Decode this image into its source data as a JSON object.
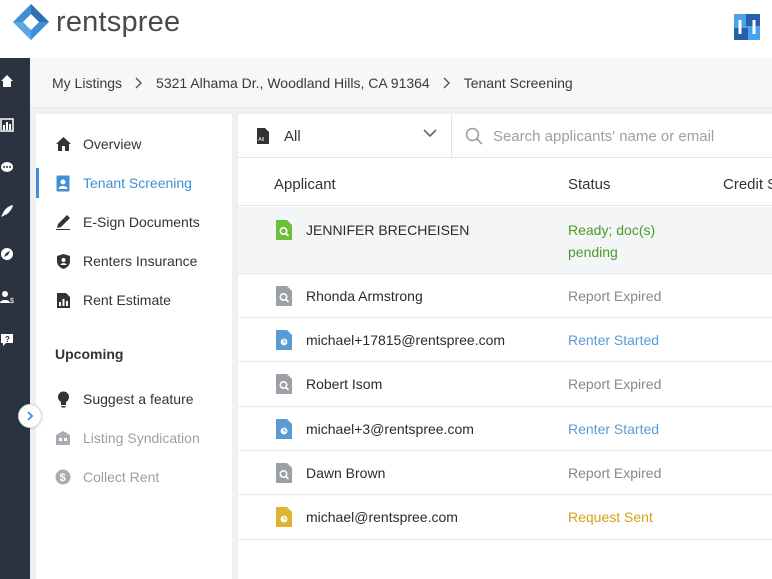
{
  "app": {
    "logo_text": "rentspree",
    "colors": {
      "accent": "#3f8fd6",
      "rail": "#2b3240",
      "ready": "#4c9a2a",
      "started": "#5b9bd5",
      "sent": "#d4a017",
      "expired": "#888888"
    }
  },
  "breadcrumb": [
    "My Listings",
    "5321 Alhama Dr., Woodland Hills, CA 91364",
    "Tenant Screening"
  ],
  "rail_icons": [
    "home-icon",
    "chart-icon",
    "chat-icon",
    "rocket-icon",
    "compass-icon",
    "users-dollar-icon",
    "help-icon"
  ],
  "subnav": {
    "items": [
      {
        "label": "Overview",
        "icon": "home-icon"
      },
      {
        "label": "Tenant Screening",
        "icon": "person-doc-icon"
      },
      {
        "label": "E-Sign Documents",
        "icon": "pen-icon"
      },
      {
        "label": "Renters Insurance",
        "icon": "shield-icon"
      },
      {
        "label": "Rent Estimate",
        "icon": "estimate-icon"
      }
    ],
    "upcoming_heading": "Upcoming",
    "upcoming": [
      {
        "label": "Suggest a feature",
        "icon": "lightbulb-icon"
      },
      {
        "label": "Listing Syndication",
        "icon": "building-icon"
      },
      {
        "label": "Collect Rent",
        "icon": "dollar-icon"
      }
    ]
  },
  "filter": {
    "selected": "All",
    "doc_badge": "All"
  },
  "search": {
    "placeholder": "Search applicants' name or email"
  },
  "table": {
    "columns": [
      "Applicant",
      "Status",
      "Credit S"
    ],
    "rows": [
      {
        "name": "JENNIFER BRECHEISEN",
        "status_line1": "Ready; doc(s)",
        "status_line2": "pending",
        "kind": "ready"
      },
      {
        "name": "Rhonda Armstrong",
        "status_line1": "Report Expired",
        "status_line2": "",
        "kind": "expired"
      },
      {
        "name": "michael+17815@rentspree.com",
        "status_line1": "Renter Started",
        "status_line2": "",
        "kind": "started"
      },
      {
        "name": "Robert Isom",
        "status_line1": "Report Expired",
        "status_line2": "",
        "kind": "expired"
      },
      {
        "name": "michael+3@rentspree.com",
        "status_line1": "Renter Started",
        "status_line2": "",
        "kind": "started"
      },
      {
        "name": "Dawn Brown",
        "status_line1": "Report Expired",
        "status_line2": "",
        "kind": "expired"
      },
      {
        "name": "michael@rentspree.com",
        "status_line1": "Request Sent",
        "status_line2": "",
        "kind": "sent"
      }
    ]
  }
}
